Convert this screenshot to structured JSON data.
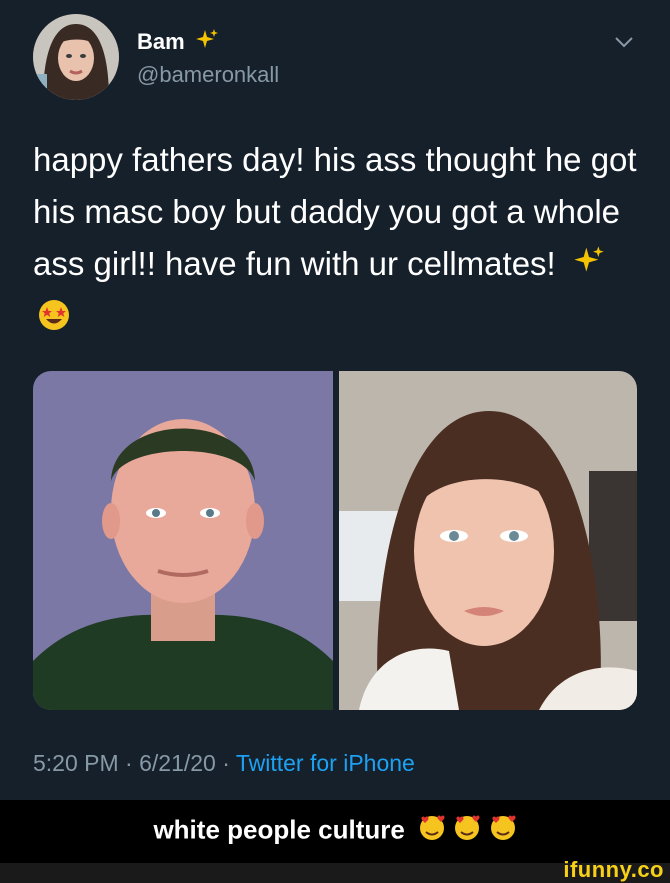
{
  "tweet": {
    "display_name": "Bam",
    "handle": "@bameronkall",
    "text": "happy fathers day! his ass thought he got his masc boy but daddy you got a whole ass girl!! have fun with ur cellmates!",
    "time": "5:20 PM · 6/21/20 · ",
    "source": "Twitter for iPhone"
  },
  "caption": "white people culture",
  "watermark": "ifunny.co",
  "colors": {
    "background": "#15202b",
    "secondary_text": "#8899a6",
    "link": "#1da1f2",
    "watermark": "#f7d117"
  },
  "icons": [
    "sparkles-icon",
    "star-struck-emoji-icon",
    "smiling-hearts-emoji-icon",
    "chevron-down-icon"
  ]
}
